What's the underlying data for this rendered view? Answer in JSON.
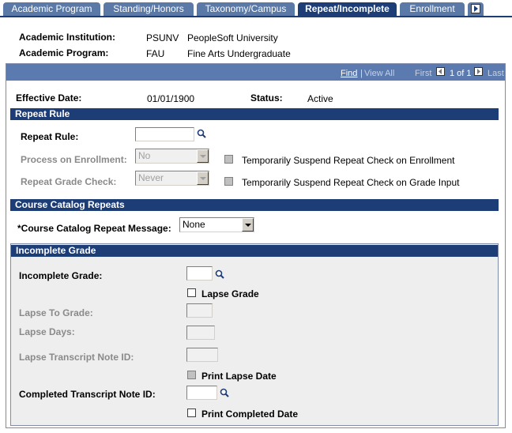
{
  "tabs": [
    {
      "label": "Academic Program",
      "active": false
    },
    {
      "label": "Standing/Honors",
      "active": false
    },
    {
      "label": "Taxonomy/Campus",
      "active": false
    },
    {
      "label": "Repeat/Incomplete",
      "active": true
    },
    {
      "label": "Enrollment",
      "active": false
    }
  ],
  "header": {
    "institution_label": "Academic Institution:",
    "institution_code": "PSUNV",
    "institution_name": "PeopleSoft University",
    "program_label": "Academic Program:",
    "program_code": "FAU",
    "program_name": "Fine Arts Undergraduate"
  },
  "navbar": {
    "find": "Find",
    "view_all": "View All",
    "first": "First",
    "page": "1 of 1",
    "last": "Last"
  },
  "effective": {
    "date_label": "Effective Date:",
    "date_value": "01/01/1900",
    "status_label": "Status:",
    "status_value": "Active"
  },
  "repeat_rule": {
    "header": "Repeat Rule",
    "rule_label": "Repeat Rule:",
    "rule_value": "",
    "process_label": "Process on Enrollment:",
    "process_value": "No",
    "grade_check_label": "Repeat Grade Check:",
    "grade_check_value": "Never",
    "suspend_enroll_label": "Temporarily Suspend Repeat Check on Enrollment",
    "suspend_grade_label": "Temporarily Suspend Repeat Check on Grade Input"
  },
  "catalog": {
    "header": "Course Catalog Repeats",
    "message_label": "*Course Catalog Repeat Message:",
    "message_value": "None"
  },
  "incomplete": {
    "header": "Incomplete Grade",
    "grade_label": "Incomplete Grade:",
    "lapse_grade_label": "Lapse Grade",
    "lapse_to_label": "Lapse To Grade:",
    "lapse_days_label": "Lapse Days:",
    "lapse_note_label": "Lapse Transcript Note ID:",
    "print_lapse_label": "Print Lapse Date",
    "completed_note_label": "Completed Transcript Note ID:",
    "print_completed_label": "Print Completed Date"
  },
  "colors": {
    "tab_inactive": "#5b79a6",
    "tab_active": "#1d3d76",
    "section_header": "#1d3d76",
    "navbar": "#5a7ab0"
  }
}
